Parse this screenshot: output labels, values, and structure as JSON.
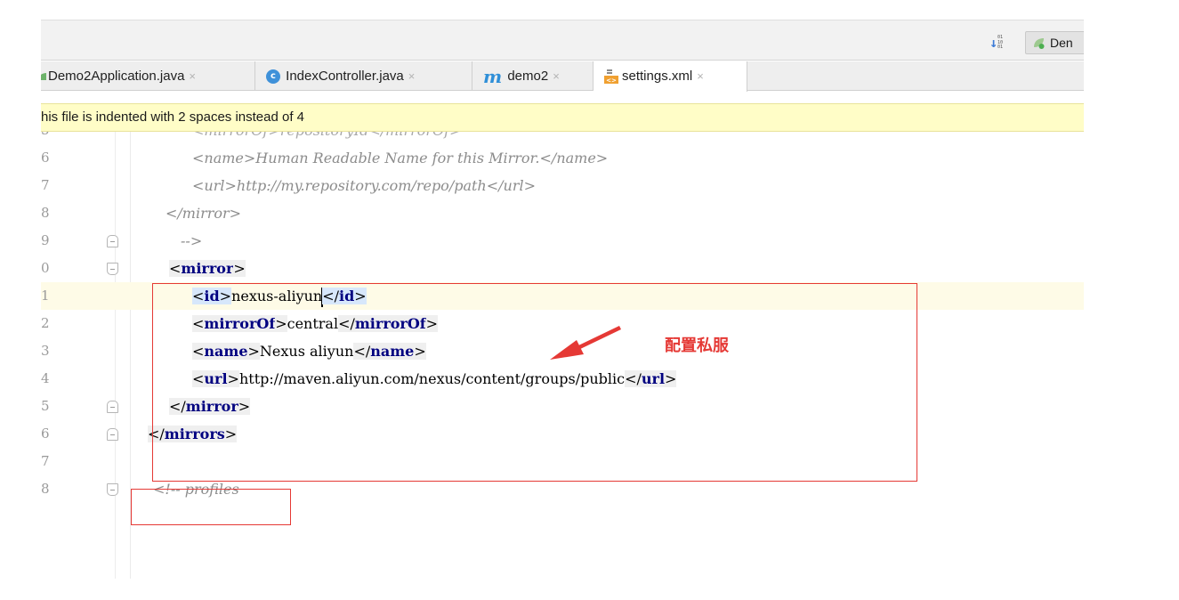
{
  "toolbar": {
    "sort_icon": "sort-binary-icon",
    "run_config_label": "Den"
  },
  "tabs": [
    {
      "label": "Demo2Application.java",
      "icon": "spring-boot-icon",
      "close": "×",
      "active": false
    },
    {
      "label": "IndexController.java",
      "icon": "class-icon",
      "icon_text": "c",
      "close": "×",
      "active": false
    },
    {
      "label": "demo2",
      "icon": "maven-icon",
      "icon_text": "m",
      "close": "×",
      "active": false
    },
    {
      "label": "settings.xml",
      "icon": "xml-file-icon",
      "close": "×",
      "active": true
    }
  ],
  "banner": {
    "message": "his file is indented with 2 spaces instead of 4"
  },
  "editor": {
    "lines": [
      {
        "num": "5"
      },
      {
        "num": "6",
        "text": "<name>Human Readable Name for this Mirror.</name>"
      },
      {
        "num": "7",
        "text": "<url>http://my.repository.com/repo/path</url>"
      },
      {
        "num": "8",
        "text": "</mirror>"
      },
      {
        "num": "9",
        "text": "-->"
      },
      {
        "num": "0",
        "open": "<",
        "tag": "mirror",
        "close": ">"
      },
      {
        "num": "1",
        "open": "<",
        "tag": "id",
        "close": ">",
        "value": "nexus-aliyun",
        "end_open": "</",
        "end_close": ">"
      },
      {
        "num": "2",
        "open": "<",
        "tag": "mirrorOf",
        "close": ">",
        "value": "central",
        "end_open": "</",
        "end_close": ">"
      },
      {
        "num": "3",
        "open": "<",
        "tag": "name",
        "close": ">",
        "value": "Nexus aliyun",
        "end_open": "</",
        "end_close": ">"
      },
      {
        "num": "4",
        "open": "<",
        "tag": "url",
        "close": ">",
        "value": "http://maven.aliyun.com/nexus/content/groups/public",
        "end_open": "</",
        "end_close": ">"
      },
      {
        "num": "5",
        "open": "</",
        "tag": "mirror",
        "close": ">"
      },
      {
        "num": "6",
        "open": "</",
        "tag": "mirrors",
        "close": ">"
      },
      {
        "num": "7"
      },
      {
        "num": "8",
        "text": "<!-- profiles"
      }
    ]
  },
  "annotation": {
    "label": "配置私服",
    "color": "#e53935"
  }
}
